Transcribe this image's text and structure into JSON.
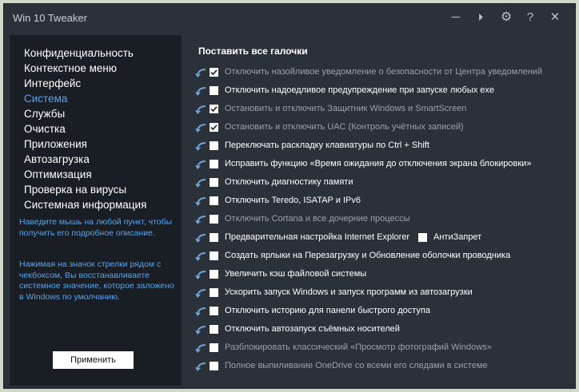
{
  "app": {
    "title": "Win 10 Tweaker"
  },
  "colors": {
    "accent": "#5aa3e8",
    "window_bg": "#2b3139",
    "sidebar_bg": "#191e25"
  },
  "titlebar_icons": [
    "minimize-icon",
    "play-icon",
    "gear-icon",
    "help-icon",
    "close-icon"
  ],
  "titlebar": {
    "minimize": "─",
    "play": "⏵",
    "gear": "⚙",
    "help": "?",
    "close": "✕"
  },
  "sidebar": {
    "items": [
      {
        "label": "Конфиденциальность"
      },
      {
        "label": "Контекстное меню"
      },
      {
        "label": "Интерфейс"
      },
      {
        "label": "Система",
        "active": true
      },
      {
        "label": "Службы"
      },
      {
        "label": "Очистка"
      },
      {
        "label": "Приложения"
      },
      {
        "label": "Автозагрузка"
      },
      {
        "label": "Оптимизация"
      },
      {
        "label": "Проверка на вирусы"
      },
      {
        "label": "Системная информация"
      }
    ],
    "hint1": "Наведите мышь на любой пункт, чтобы получить его подробное описание.",
    "hint2": "Нажимая на значок стрелки рядом с чекбоксом, Вы восстанавливаете системное значение, которое заложено в Windows по умолчанию.",
    "apply_label": "Применить"
  },
  "main": {
    "heading": "Поставить все галочки",
    "options": [
      {
        "label": "Отключить назойливое уведомление о безопасности от Центра уведомлений",
        "checked": true,
        "dim": true
      },
      {
        "label": "Отключить надоедливое предупреждение при запуске любых exe",
        "checked": false,
        "dim": false
      },
      {
        "label": "Остановить и отключить Защитник Windows и SmartScreen",
        "checked": true,
        "dim": true
      },
      {
        "label": "Остановить и отключить UAC (Контроль учётных записей)",
        "checked": true,
        "dim": true
      },
      {
        "label": "Переключать раскладку клавиатуры по Ctrl + Shift",
        "checked": false,
        "dim": false
      },
      {
        "label": "Исправить функцию «Время ожидания до отключения экрана блокировки»",
        "checked": false,
        "dim": false
      },
      {
        "label": "Отключить диагностику памяти",
        "checked": false,
        "dim": false
      },
      {
        "label": "Отключить Teredo, ISATAP и IPv6",
        "checked": false,
        "dim": false
      },
      {
        "label": "Отключить Cortana и все дочерние процессы",
        "checked": false,
        "dim": true
      },
      {
        "label": "Предварительная настройка Internet Explorer",
        "checked": false,
        "dim": false,
        "extra": {
          "label": "АнтиЗапрет",
          "checked": false
        }
      },
      {
        "label": "Создать ярлыки на Перезагрузку и Обновление оболочки проводника",
        "checked": false,
        "dim": false
      },
      {
        "label": "Увеличить кэш файловой системы",
        "checked": false,
        "dim": false
      },
      {
        "label": "Ускорить запуск Windows и запуск программ из автозагрузки",
        "checked": false,
        "dim": false
      },
      {
        "label": "Отключить историю для панели быстрого доступа",
        "checked": false,
        "dim": false
      },
      {
        "label": "Отключить автозапуск съёмных носителей",
        "checked": false,
        "dim": false
      },
      {
        "label": "Разблокировать классический «Просмотр фотографий Windows»",
        "checked": false,
        "dim": true
      },
      {
        "label": "Полное выпиливание OneDrive со всеми его следами в системе",
        "checked": false,
        "dim": true
      }
    ]
  }
}
